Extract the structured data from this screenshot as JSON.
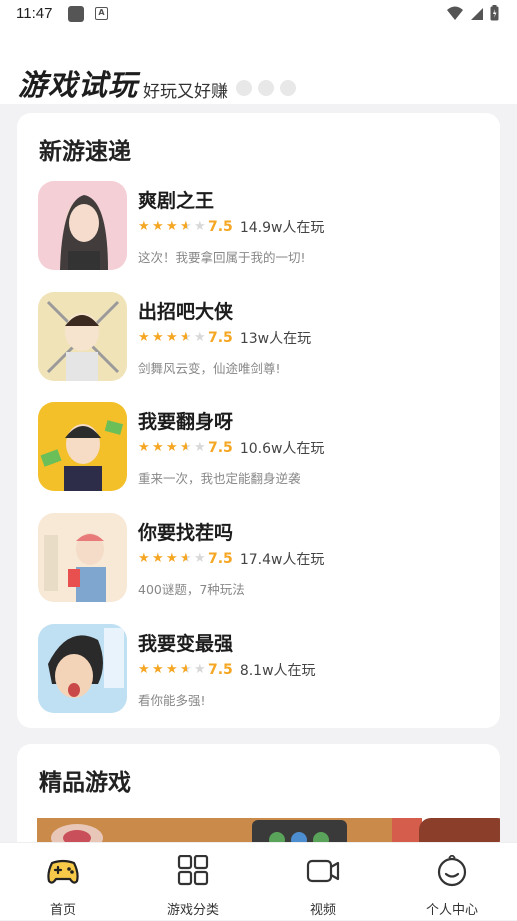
{
  "status_bar": {
    "time": "11:47",
    "notification_letter": "A"
  },
  "header": {
    "title": "游戏试玩",
    "subtitle": "好玩又好赚"
  },
  "new_games": {
    "title": "新游速递",
    "games": [
      {
        "name": "爽剧之王",
        "rating": "7.5",
        "players": "14.9w人在玩",
        "desc": "这次！我要拿回属于我的一切!",
        "stars_filled": 3.5,
        "icon_bg": "#f4cfd6"
      },
      {
        "name": "出招吧大侠",
        "rating": "7.5",
        "players": "13w人在玩",
        "desc": "剑舞风云变，仙途唯剑尊!",
        "stars_filled": 3.5,
        "icon_bg": "#f1e3b8"
      },
      {
        "name": "我要翻身呀",
        "rating": "7.5",
        "players": "10.6w人在玩",
        "desc": "重来一次，我也定能翻身逆袭",
        "stars_filled": 3.5,
        "icon_bg": "#f3c02a"
      },
      {
        "name": "你要找茬吗",
        "rating": "7.5",
        "players": "17.4w人在玩",
        "desc": "400谜题，7种玩法",
        "stars_filled": 3.5,
        "icon_bg": "#f7e9d6"
      },
      {
        "name": "我要变最强",
        "rating": "7.5",
        "players": "8.1w人在玩",
        "desc": "看你能多强!",
        "stars_filled": 3.5,
        "icon_bg": "#bfe0f3"
      }
    ]
  },
  "featured": {
    "title": "精品游戏"
  },
  "nav": [
    {
      "label": "首页",
      "icon": "gamepad-icon",
      "active": true
    },
    {
      "label": "游戏分类",
      "icon": "grid-icon",
      "active": false
    },
    {
      "label": "视频",
      "icon": "video-camera-icon",
      "active": false
    },
    {
      "label": "个人中心",
      "icon": "smiley-face-icon",
      "active": false
    }
  ],
  "colors": {
    "star": "#f5a623",
    "accent_yellow": "#f7c948",
    "background": "#f2f2f4"
  }
}
